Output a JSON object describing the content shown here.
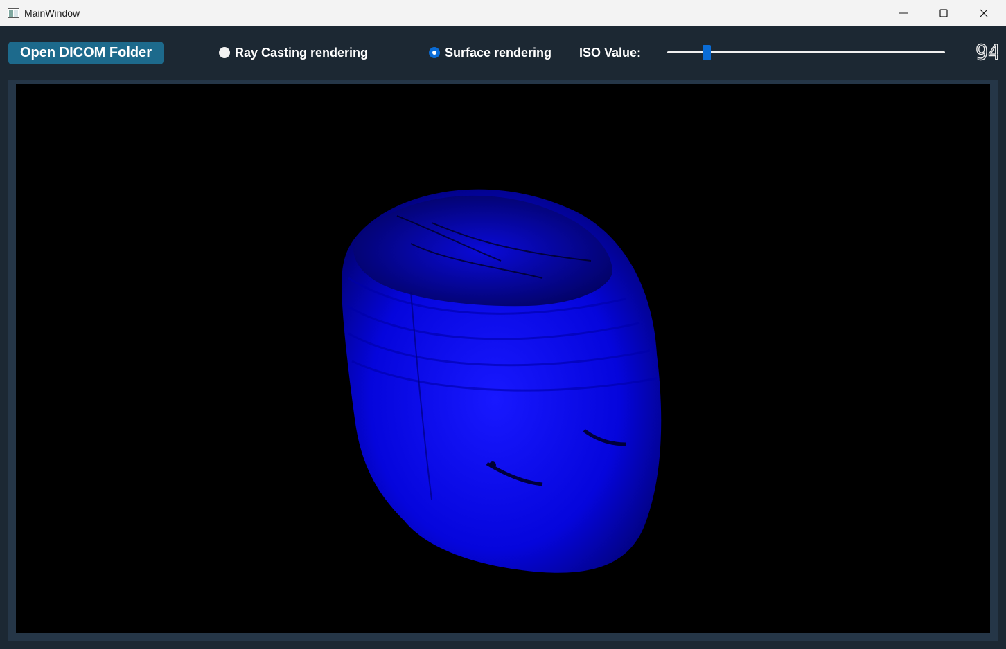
{
  "window": {
    "title": "MainWindow"
  },
  "toolbar": {
    "open_button_label": "Open DICOM Folder",
    "ray_casting_label": "Ray Casting rendering",
    "surface_label": "Surface rendering",
    "iso_label": "ISO Value:",
    "iso_value": "94",
    "selected_mode": "Surface rendering",
    "iso_slider_fraction": 0.13
  },
  "colors": {
    "accent": "#0a6cd6",
    "button": "#1d6a8c",
    "surface": "#0000ff",
    "background": "#1c2833"
  },
  "icons": [
    "app-icon",
    "minimize-icon",
    "maximize-icon",
    "close-icon"
  ]
}
